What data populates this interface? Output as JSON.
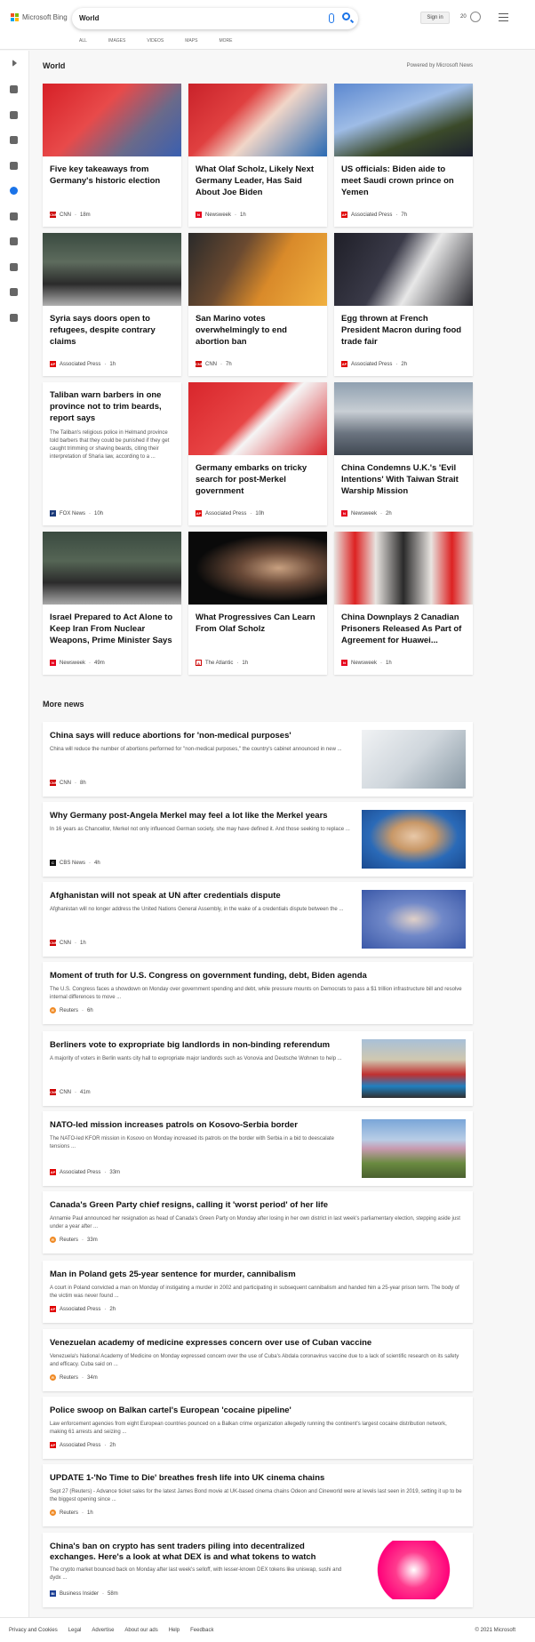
{
  "header": {
    "brand": "Microsoft Bing",
    "query": "World",
    "scopes": [
      "ALL",
      "IMAGES",
      "VIDEOS",
      "MAPS",
      "MORE"
    ],
    "signin": "Sign in",
    "rewards": "20"
  },
  "world": {
    "title": "World",
    "powered": "Powered by Microsoft News",
    "cards": [
      {
        "title": "Five key takeaways from Germany's historic election",
        "source": "CNN",
        "time": "18m",
        "logo": "CNN",
        "logo_color": "#cc0000",
        "img": "linear-gradient(135deg,#d62027 0%,#e84a4a 40%,#6a6a8a 70%,#3a5fb0 100%)"
      },
      {
        "title": "What Olaf Scholz, Likely Next Germany Leader, Has Said About Joe Biden",
        "source": "Newsweek",
        "time": "1h",
        "logo": "N",
        "logo_color": "#e6001c",
        "img": "linear-gradient(135deg,#c9222a 0%,#e04040 35%,#f1d6c8 55%,#2a6ab3 100%)"
      },
      {
        "title": "US officials: Biden aide to meet Saudi crown prince on Yemen",
        "source": "Associated Press",
        "time": "7h",
        "logo": "AP",
        "logo_color": "#e00000",
        "img": "linear-gradient(160deg,#5c88d0 0%,#9ebce6 40%,#3b4a2a 70%,#1c2030 100%)"
      },
      {
        "title": "Syria says doors open to refugees, despite contrary claims",
        "source": "Associated Press",
        "time": "1h",
        "logo": "AP",
        "logo_color": "#e00000",
        "img": "linear-gradient(180deg,#3a4a40 0%,#5d6b5d 40%,#2b2b2b 70%,#b0b0b0 100%)"
      },
      {
        "title": "San Marino votes overwhelmingly to end abortion ban",
        "source": "CNN",
        "time": "7h",
        "logo": "CNN",
        "logo_color": "#cc0000",
        "img": "linear-gradient(120deg,#2a2a2a 0%,#6b4a30 35%,#d98a2a 60%,#f0b040 100%)"
      },
      {
        "title": "Egg thrown at French President Macron during food trade fair",
        "source": "Associated Press",
        "time": "2h",
        "logo": "AP",
        "logo_color": "#e00000",
        "img": "linear-gradient(120deg,#1f1f28 0%,#3a3a48 40%,#e8e8e8 60%,#2a2a30 100%)"
      },
      {
        "title": "Taliban warn barbers in one province not to trim beards, report says",
        "desc": "The Taliban's religious police in Helmand province told barbers that they could be punished if they get caught trimming or shaving beards, citing their interpretation of Sharia law, according to a ...",
        "source": "FOX News",
        "time": "10h",
        "logo": "F",
        "logo_color": "#1b3a7a",
        "img": ""
      },
      {
        "title": "Germany embarks on tricky search for post-Merkel government",
        "source": "Associated Press",
        "time": "10h",
        "logo": "AP",
        "logo_color": "#e00000",
        "img": "linear-gradient(135deg,#d8262c 0%,#e84545 45%,#f5f5f5 55%,#d8262c 100%)"
      },
      {
        "title": "China Condemns U.K.'s 'Evil Intentions' With Taiwan Strait Warship Mission",
        "source": "Newsweek",
        "time": "2h",
        "logo": "N",
        "logo_color": "#e6001c",
        "img": "linear-gradient(180deg,#8fa0b0 0%,#c8ced4 40%,#6b7480 70%,#404852 100%)"
      },
      {
        "title": "Israel Prepared to Act Alone to Keep Iran From Nuclear Weapons, Prime Minister Says",
        "source": "Newsweek",
        "time": "49m",
        "logo": "N",
        "logo_color": "#e6001c",
        "img": "linear-gradient(180deg,#3a4a40 0%,#556555 40%,#2b2b2b 70%,#a8a8a8 100%)"
      },
      {
        "title": "What Progressives Can Learn From Olaf Scholz",
        "source": "The Atlantic",
        "time": "1h",
        "logo": "A",
        "logo_color": "#ffffff",
        "img": "radial-gradient(ellipse at 65% 50%,#c8a080 0%,#6a4a38 30%,#0a0a0a 65%)"
      },
      {
        "title": "China Downplays 2 Canadian Prisoners Released As Part of Agreement for Huawei...",
        "source": "Newsweek",
        "time": "1h",
        "logo": "N",
        "logo_color": "#e6001c",
        "img": "linear-gradient(90deg,#e8e4e0 0%,#d22 15%,#e8e4e0 30%,#2a2a2a 50%,#e8e4e0 70%,#d22 85%,#e8e4e0 100%)"
      }
    ]
  },
  "more": {
    "title": "More news",
    "items": [
      {
        "title": "China says will reduce abortions for 'non-medical purposes'",
        "desc": "China will reduce the number of abortions performed for \"non-medical purposes,\" the country's cabinet announced in new ...",
        "source": "CNN",
        "time": "8h",
        "logo": "CNN",
        "logo_color": "#cc0000",
        "thumb": "linear-gradient(135deg,#f0f2f4 0%,#cfd6dc 50%,#8a9aa6 100%)"
      },
      {
        "title": "Why Germany post-Angela Merkel may feel a lot like the Merkel years",
        "desc": "In 16 years as Chancellor, Merkel not only influenced German society, she may have defined it. And those seeking to replace ...",
        "source": "CBS News",
        "time": "4h",
        "logo": "C",
        "logo_color": "#111111",
        "thumb": "radial-gradient(ellipse at 50% 45%,#e8c8a8 0%,#c89868 30%,#2a6ab8 60%,#1a4a90 100%)"
      },
      {
        "title": "Afghanistan will not speak at UN after credentials dispute",
        "desc": "Afghanistan will no longer address the United Nations General Assembly, in the wake of a credentials dispute between the ...",
        "source": "CNN",
        "time": "1h",
        "logo": "CNN",
        "logo_color": "#cc0000",
        "thumb": "radial-gradient(ellipse at 50% 50%,#e0d0c8 0%,#7088c8 40%,#3a58a8 100%)"
      },
      {
        "title": "Moment of truth for U.S. Congress on government funding, debt, Biden agenda",
        "desc": "The U.S. Congress faces a showdown on Monday over government spending and debt, while pressure mounts on Democrats to pass a $1 trillion infrastructure bill and resolve internal differences to move ...",
        "source": "Reuters",
        "time": "6h",
        "logo": "R",
        "logo_color": "#f08a24",
        "thumb": ""
      },
      {
        "title": "Berliners vote to expropriate big landlords in non-binding referendum",
        "desc": "A majority of voters in Berlin wants city hall to expropriate major landlords such as Vonovia and Deutsche Wohnen to help ...",
        "source": "CNN",
        "time": "41m",
        "logo": "CNN",
        "logo_color": "#cc0000",
        "thumb": "linear-gradient(180deg,#a8c0d8 0%,#d0c8b0 35%,#c03030 60%,#2080c0 80%,#303030 100%)"
      },
      {
        "title": "NATO-led mission increases patrols on Kosovo-Serbia border",
        "desc": "The NATO-led KFOR mission in Kosovo on Monday increased its patrols on the border with Serbia in a bid to deescalate tensions ...",
        "source": "Associated Press",
        "time": "33m",
        "logo": "AP",
        "logo_color": "#e00000",
        "thumb": "linear-gradient(180deg,#7aa6d8 0%,#b8cde6 35%,#c89ab0 50%,#6a8a40 75%,#4a6030 100%)"
      },
      {
        "title": "Canada's Green Party chief resigns, calling it 'worst period' of her life",
        "desc": "Annamie Paul announced her resignation as head of Canada's Green Party on Monday after losing in her own district in last week's parliamentary election, stepping aside just under a year after ...",
        "source": "Reuters",
        "time": "33m",
        "logo": "R",
        "logo_color": "#f08a24",
        "thumb": ""
      },
      {
        "title": "Man in Poland gets 25-year sentence for murder, cannibalism",
        "desc": "A court in Poland convicted a man on Monday of instigating a murder in 2002 and participating in subsequent cannibalism and handed him a 25-year prison term. The body of the victim was never found ...",
        "source": "Associated Press",
        "time": "2h",
        "logo": "AP",
        "logo_color": "#e00000",
        "thumb": ""
      },
      {
        "title": "Venezuelan academy of medicine expresses concern over use of Cuban vaccine",
        "desc": "Venezuela's National Academy of Medicine on Monday expressed concern over the use of Cuba's Abdala coronavirus vaccine due to a lack of scientific research on its safety and efficacy. Cuba said on ...",
        "source": "Reuters",
        "time": "34m",
        "logo": "R",
        "logo_color": "#f08a24",
        "thumb": ""
      },
      {
        "title": "Police swoop on Balkan cartel's European 'cocaine pipeline'",
        "desc": "Law enforcement agencies from eight European countries pounced on a Balkan crime organization allegedly running the continent's largest cocaine distribution network, making 61 arrests and seizing ...",
        "source": "Associated Press",
        "time": "2h",
        "logo": "AP",
        "logo_color": "#e00000",
        "thumb": ""
      },
      {
        "title": "UPDATE 1-'No Time to Die' breathes fresh life into UK cinema chains",
        "desc": "Sept 27 (Reuters) - Advance ticket sales for the latest James Bond movie at UK-based cinema chains Odeon and Cineworld were at levels last seen in 2019, setting it up to be the biggest opening since ...",
        "source": "Reuters",
        "time": "1h",
        "logo": "R",
        "logo_color": "#f08a24",
        "thumb": ""
      },
      {
        "title": "China's ban on crypto has sent traders piling into decentralized exchanges. Here's a look at what DEX is and what tokens to watch",
        "desc": "The crypto market bounced back on Monday after last week's selloff, with lesser-known DEX tokens like uniswap, sushi and dydx ...",
        "source": "Business Insider",
        "time": "58m",
        "logo": "BI",
        "logo_color": "#1c3f94",
        "thumb": "radial-gradient(circle at 50% 50%,#ffffff 0%,#ff3b8e 30%,#ff007a 60%,#ffffff 61%)"
      }
    ]
  },
  "footer": {
    "links": [
      "Privacy and Cookies",
      "Legal",
      "Advertise",
      "About our ads",
      "Help",
      "Feedback"
    ],
    "copyright": "© 2021 Microsoft"
  }
}
